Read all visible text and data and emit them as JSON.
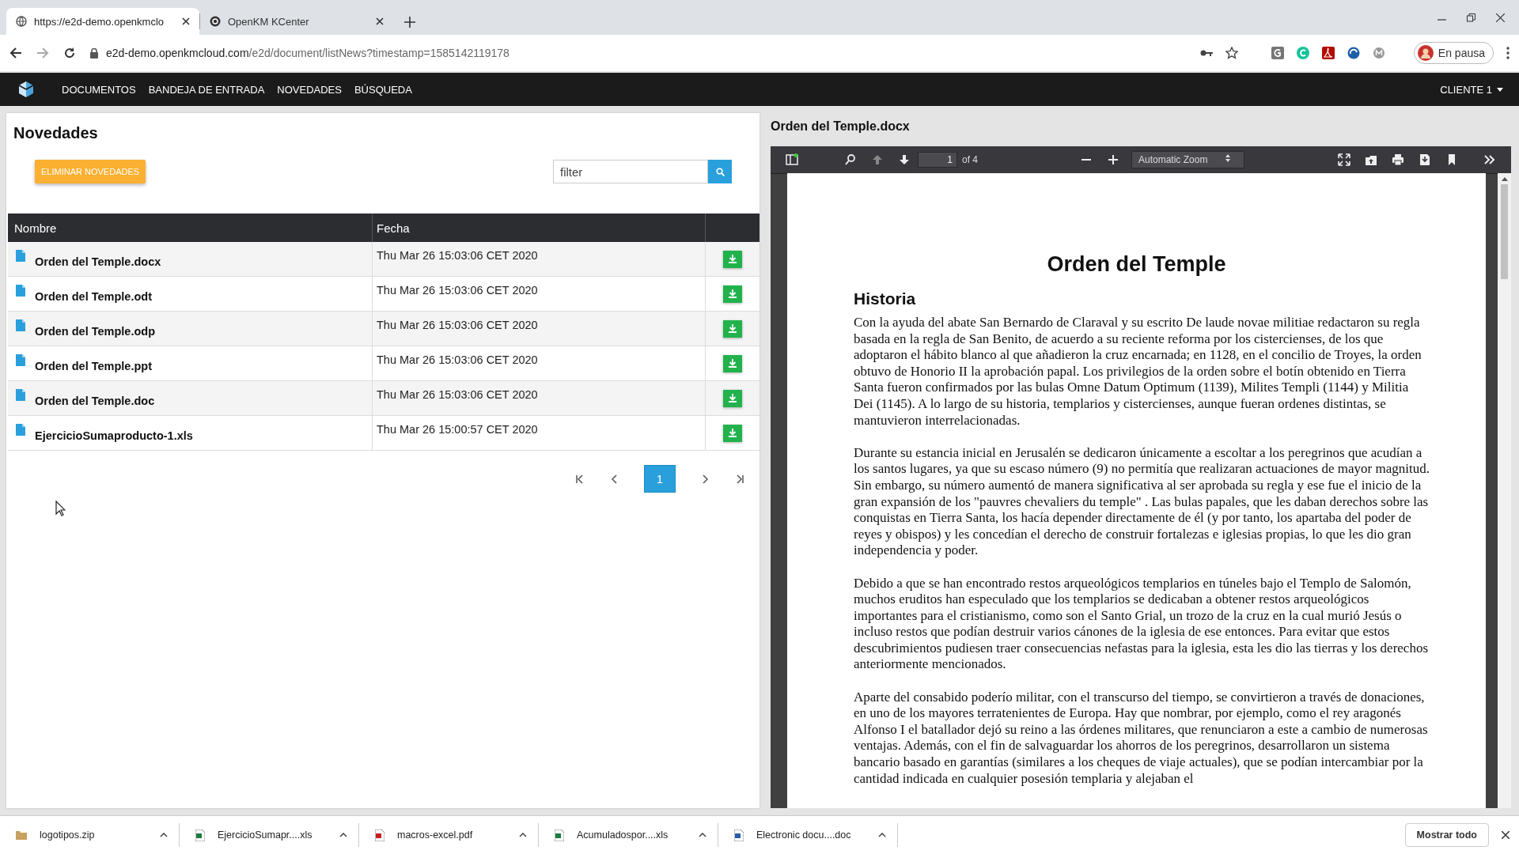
{
  "browser": {
    "tabs": [
      {
        "title": "https://e2d-demo.openkmclo",
        "selected": true
      },
      {
        "title": "OpenKM KCenter",
        "selected": false
      }
    ],
    "url_host": "e2d-demo.openkmcloud.com",
    "url_path": "/e2d/document/listNews?timestamp=1585142119178",
    "profile_button": "En pausa"
  },
  "nav": {
    "items": [
      "DOCUMENTOS",
      "BANDEJA DE ENTRADA",
      "NOVEDADES",
      "BÚSQUEDA"
    ],
    "user_menu": "CLIENTE 1"
  },
  "news": {
    "title": "Novedades",
    "delete_button": "ELIMINAR NOVEDADES",
    "search": {
      "placeholder": "filter"
    },
    "table": {
      "columns": [
        "Nombre",
        "Fecha"
      ],
      "rows": [
        {
          "name": "Orden del Temple.docx",
          "date": "Thu Mar 26 15:03:06 CET 2020"
        },
        {
          "name": "Orden del Temple.odt",
          "date": "Thu Mar 26 15:03:06 CET 2020"
        },
        {
          "name": "Orden del Temple.odp",
          "date": "Thu Mar 26 15:03:06 CET 2020"
        },
        {
          "name": "Orden del Temple.ppt",
          "date": "Thu Mar 26 15:03:06 CET 2020"
        },
        {
          "name": "Orden del Temple.doc",
          "date": "Thu Mar 26 15:03:06 CET 2020"
        },
        {
          "name": "EjercicioSumaproducto-1.xls",
          "date": "Thu Mar 26 15:00:57 CET 2020"
        }
      ]
    },
    "pagination": {
      "pages": [
        {
          "label": "1",
          "selected": true
        }
      ]
    }
  },
  "viewer": {
    "title": "Orden del Temple.docx",
    "toolbar": {
      "page": "1",
      "page_count": "of 4",
      "zoom": "Automatic Zoom"
    },
    "document": {
      "title": "Orden del Temple",
      "heading": "Historia",
      "paragraphs": [
        "Con la ayuda del abate San Bernardo de Claraval y su escrito De laude novae militiae redactaron su regla basada en la regla de San Benito, de acuerdo a su reciente reforma por los cistercienses, de los que adoptaron el hábito blanco al que añadieron la cruz encarnada; en 1128, en el concilio de Troyes, la orden obtuvo de Honorio II la aprobación papal. Los privilegios de la orden sobre el botín obtenido en Tierra Santa fueron confirmados por las bulas Omne Datum Optimum (1139), Milites Templi (1144) y Militia Dei (1145). A lo largo de su historia, templarios y cistercienses, aunque fueran ordenes distintas, se mantuvieron interrelacionadas.",
        "Durante su estancia inicial en Jerusalén se dedicaron únicamente a escoltar a los peregrinos que acudían a los santos lugares, ya que su escaso número (9) no permitía que realizaran actuaciones de mayor magnitud. Sin embargo, su número aumentó de manera significativa al ser aprobada su regla y ese fue el inicio de la gran expansión de los \"pauvres chevaliers du temple\" . Las bulas papales, que les daban derechos sobre las conquistas en Tierra Santa, los hacía depender directamente de él (y por tanto, los apartaba del poder de reyes y obispos) y les concedían el derecho de construir fortalezas e iglesias propias, lo que les dio gran independencia y poder.",
        "Debido a que se han encontrado restos arqueológicos templarios en túneles bajo el Templo de Salomón, muchos eruditos han especulado que los templarios se dedicaban a obtener restos arqueológicos importantes para el cristianismo, como son el Santo Grial, un trozo de la cruz en la cual murió Jesús o incluso restos que podían destruir varios cánones de la iglesia de ese entonces. Para evitar que estos descubrimientos pudiesen traer consecuencias nefastas para la iglesia, esta les dio las tierras y los derechos anteriormente mencionados.",
        "Aparte del consabido poderío militar, con el transcurso del tiempo, se convirtieron a través de donaciones, en uno de los mayores terratenientes de Europa. Hay que nombrar, por ejemplo, como el rey aragonés Alfonso I el batallador dejó su reino a las órdenes militares, que renunciaron a este a cambio de numerosas ventajas. Además, con el fin de salvaguardar los ahorros de los peregrinos, desarrollaron un sistema bancario basado en garantías (similares a los cheques de viaje actuales), que se podían intercambiar por la cantidad indicada en cualquier posesión templaria y alejaban el"
      ]
    }
  },
  "downloads": {
    "items": [
      {
        "name": "logotipos.zip",
        "kind": "zip"
      },
      {
        "name": "EjercicioSumapr....xls",
        "kind": "xls"
      },
      {
        "name": "macros-excel.pdf",
        "kind": "pdf"
      },
      {
        "name": "Acumuladospor....xls",
        "kind": "xls"
      },
      {
        "name": "Electronic docu....doc",
        "kind": "doc"
      }
    ],
    "show_all": "Mostrar todo"
  }
}
